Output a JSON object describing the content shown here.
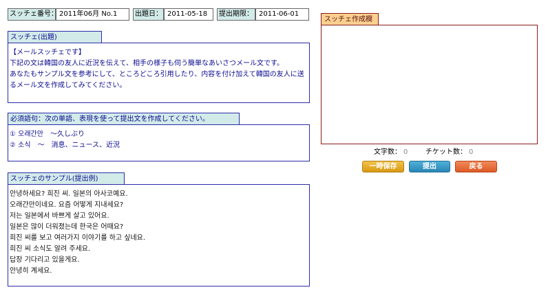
{
  "info": {
    "number_label": "スッチェ番号：",
    "number_value": "2011年06月 No.1",
    "issue_label": "出題日：",
    "issue_value": "2011-05-18",
    "deadline_label": "提出期限：",
    "deadline_value": "2011-06-01"
  },
  "question": {
    "title": "スッチェ(出題)",
    "lines": [
      "【メールスッチェです】",
      "下記の文は韓国の友人に近況を伝えて、相手の様子も伺う簡単なあいさつメール文です。",
      "あなたもサンプル文を参考にして、ところどころ引用したり、内容を付け加えて韓国の友人に送",
      "るメール文を作成してみてください。"
    ]
  },
  "required": {
    "title": "必須語句：次の単語、表現を使って提出文を作成してください。",
    "lines": [
      "① 오래간만　～久しぶり",
      "② 소식　～　消息、ニュース、近況"
    ]
  },
  "sample": {
    "title": "スッチェのサンプル(提出例)",
    "lines": [
      "안녕하세요? 희진 씨. 일본의 아사코예요.",
      "오래간만이네요. 요즘 어떻게 지내세요?",
      "저는 일본에서 바쁘게 살고 있어요.",
      "일본은 많이 더워졌는데 한국은 어때요?",
      "희진 씨를 보고 여러가지 이야기를 하고 싶네요.",
      "희진 씨 소식도 알려 주세요.",
      "답장 기다리고 있을게요.",
      "안녕히 계세요."
    ]
  },
  "composer": {
    "title": "スッチェ作成欄",
    "text": "",
    "char_count_label": "文字数：",
    "char_count": "0",
    "ticket_count_label": "チケット数：",
    "ticket_count": "0"
  },
  "buttons": {
    "save": "一時保存",
    "submit": "提出",
    "back": "戻る"
  },
  "colors": {
    "label_bg": "#d2ebe9",
    "section_border": "#2a2aa8",
    "section_text": "#0b0b90",
    "composer_border": "#8b1a1a",
    "composer_title_bg": "#fbd08f",
    "save_button": "#e0a820",
    "submit_button": "#2f90c0",
    "back_button": "#e2642e"
  }
}
